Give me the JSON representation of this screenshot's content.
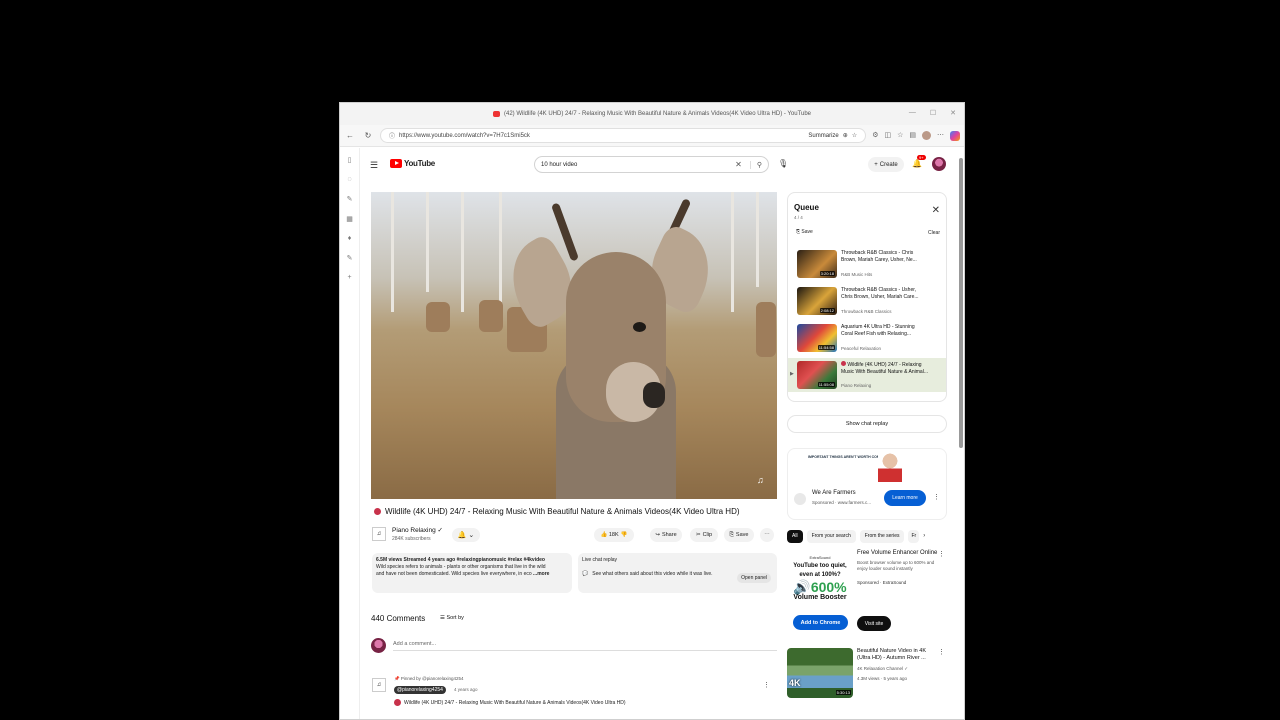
{
  "window": {
    "title": "(42) Wildlife (4K UHD) 24/7 - Relaxing Music With Beautiful Nature & Animals Videos(4K Video Ultra HD) - YouTube"
  },
  "browser": {
    "url": "https://www.youtube.com/watch?v=7H7c1Smi5ck",
    "summarize": "Summarize"
  },
  "yt": {
    "logo": "YouTube",
    "search_value": "10 hour video",
    "create_label": "Create",
    "notif_count": "9+"
  },
  "video": {
    "title": "Wildlife (4K UHD) 24/7 - Relaxing Music With Beautiful Nature & Animals Videos(4K Video Ultra HD)",
    "channel": "Piano Relaxing",
    "subscribers": "284K subscribers",
    "likes": "18K",
    "share": "Share",
    "clip": "Clip",
    "save": "Save"
  },
  "description": {
    "meta": "6.5M views  Streamed 4 years ago  #relaxingpianomusic #relax #4kvideo",
    "line1": "Wild species refers to animals - plants or other organisms that live in the wild",
    "line2": "and have not been domesticated. Wild species live everywhere, in eco",
    "more": "...more"
  },
  "live_chat": {
    "title": "Live chat replay",
    "text": "See what others said about this video while it was live.",
    "button": "Open panel"
  },
  "comments": {
    "count": "440 Comments",
    "sort": "Sort by",
    "placeholder": "Add a comment...",
    "pinned_by": "Pinned by @pianorelaxing4254",
    "author": "@pianorelaxing4254",
    "when": "4 years ago",
    "text": "Wildlife (4K UHD) 24/7 - Relaxing Music With Beautiful Nature & Animals Videos(4K Video Ultra HD)"
  },
  "queue": {
    "title": "Queue",
    "count": "4 / 4",
    "save": "Save",
    "clear": "Clear",
    "items": [
      {
        "title1": "Throwback R&B Classics - Chris",
        "title2": "Brown, Mariah Carey, Usher, Ne...",
        "channel": "R&B Music Hits",
        "duration": "3:20:18"
      },
      {
        "title1": "Throwback R&B Classics - Usher,",
        "title2": "Chris Brown, Usher, Mariah Care...",
        "channel": "Throwback R&B Classics",
        "duration": "2:08:12"
      },
      {
        "title1": "Aquarium 4K Ultra HD - Stunning",
        "title2": "Coral Reef Fish with Relaxing...",
        "channel": "Peaceful Relaxation",
        "duration": "11:54:58"
      },
      {
        "title1": "Wildlife (4K UHD) 24/7 - Relaxing",
        "title2": "Music With Beautiful Nature & Animal...",
        "channel": "Piano Relaxing",
        "duration": "11:55:08"
      }
    ]
  },
  "show_chat_replay": "Show chat replay",
  "ad1": {
    "banner": "IMPORTANT THINGS AREN'T WORTH COMPROMISING",
    "name": "We Are Farmers",
    "sponsored": "Sponsored · www.farmers.c...",
    "cta": "Learn more"
  },
  "chips": [
    "All",
    "From your search",
    "From the series",
    "Fr"
  ],
  "ad2": {
    "brand": "ExtraSound",
    "art1": "YouTube too quiet,",
    "art2": "even at 100%?",
    "pct": "600%",
    "art3": "Volume Booster",
    "add": "Add to Chrome",
    "visit": "Visit site",
    "title": "Free Volume Enhancer Online",
    "desc": "Boost browser volume up to 600% and enjoy louder sound instantly",
    "sponsored": "Sponsored · ExtraSound"
  },
  "rec": {
    "title1": "Beautiful Nature Video in 4K",
    "title2": "(Ultra HD) - Autumn River ...",
    "channel": "4K Relaxation Channel",
    "views": "4.3M views · 5 years ago",
    "duration": "5:30:13",
    "badge": "4K"
  }
}
